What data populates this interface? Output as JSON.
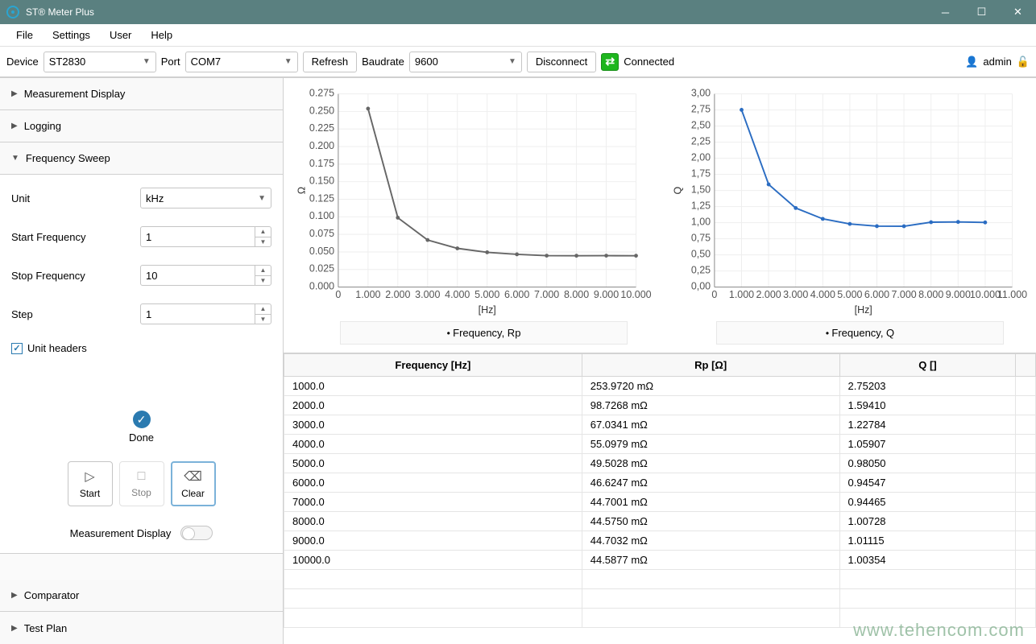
{
  "window": {
    "title": "ST® Meter Plus"
  },
  "menubar": {
    "items": [
      "File",
      "Settings",
      "User",
      "Help"
    ]
  },
  "toolbar": {
    "device_label": "Device",
    "device_value": "ST2830",
    "port_label": "Port",
    "port_value": "COM7",
    "refresh": "Refresh",
    "baudrate_label": "Baudrate",
    "baudrate_value": "9600",
    "disconnect": "Disconnect",
    "status": "Connected",
    "user": "admin"
  },
  "sidebar": {
    "sections": {
      "measurement_display": "Measurement Display",
      "logging": "Logging",
      "frequency_sweep": "Frequency Sweep",
      "comparator": "Comparator",
      "test_plan": "Test Plan"
    },
    "sweep": {
      "unit_label": "Unit",
      "unit_value": "kHz",
      "start_label": "Start Frequency",
      "start_value": "1",
      "stop_label": "Stop Frequency",
      "stop_value": "10",
      "step_label": "Step",
      "step_value": "1",
      "unit_headers": "Unit headers"
    },
    "done_label": "Done",
    "buttons": {
      "start": "Start",
      "stop": "Stop",
      "clear": "Clear"
    },
    "toggle_label": "Measurement Display"
  },
  "chart_data": [
    {
      "type": "line",
      "title": "",
      "xlabel": "[Hz]",
      "ylabel": "Ω",
      "legend": "Frequency, Rp",
      "x": [
        1000,
        2000,
        3000,
        4000,
        5000,
        6000,
        7000,
        8000,
        9000,
        10000
      ],
      "y": [
        0.254,
        0.0987,
        0.067,
        0.0551,
        0.0495,
        0.0466,
        0.0447,
        0.0446,
        0.0447,
        0.0446
      ],
      "xlim": [
        0,
        10000
      ],
      "ylim": [
        0,
        0.275
      ],
      "xticks": [
        0,
        1000,
        2000,
        3000,
        4000,
        5000,
        6000,
        7000,
        8000,
        9000,
        10000
      ],
      "yticks": [
        0.0,
        0.025,
        0.05,
        0.075,
        0.1,
        0.125,
        0.15,
        0.175,
        0.2,
        0.225,
        0.25,
        0.275
      ],
      "yticklabels": [
        "0.000",
        "0.025",
        "0.050",
        "0.075",
        "0.100",
        "0.125",
        "0.150",
        "0.175",
        "0.200",
        "0.225",
        "0.250",
        "0.275"
      ],
      "color": "#666"
    },
    {
      "type": "line",
      "title": "",
      "xlabel": "[Hz]",
      "ylabel": "Q",
      "legend": "Frequency, Q",
      "x": [
        1000,
        2000,
        3000,
        4000,
        5000,
        6000,
        7000,
        8000,
        9000,
        10000
      ],
      "y": [
        2.75203,
        1.5941,
        1.22784,
        1.05907,
        0.9805,
        0.94547,
        0.94465,
        1.00728,
        1.01115,
        1.00354
      ],
      "xlim": [
        0,
        11000
      ],
      "ylim": [
        0,
        3.0
      ],
      "xticks": [
        0,
        1000,
        2000,
        3000,
        4000,
        5000,
        6000,
        7000,
        8000,
        9000,
        10000,
        11000
      ],
      "yticks": [
        0.0,
        0.25,
        0.5,
        0.75,
        1.0,
        1.25,
        1.5,
        1.75,
        2.0,
        2.25,
        2.5,
        2.75,
        3.0
      ],
      "yticklabels": [
        "0,00",
        "0,25",
        "0,50",
        "0,75",
        "1,00",
        "1,25",
        "1,50",
        "1,75",
        "2,00",
        "2,25",
        "2,50",
        "2,75",
        "3,00"
      ],
      "color": "#2a6cc2"
    }
  ],
  "table": {
    "headers": [
      "Frequency [Hz]",
      "Rp [Ω]",
      "Q []"
    ],
    "rows": [
      [
        "1000.0",
        "253.9720 mΩ",
        "2.75203"
      ],
      [
        "2000.0",
        "98.7268 mΩ",
        "1.59410"
      ],
      [
        "3000.0",
        "67.0341 mΩ",
        "1.22784"
      ],
      [
        "4000.0",
        "55.0979 mΩ",
        "1.05907"
      ],
      [
        "5000.0",
        "49.5028 mΩ",
        "0.98050"
      ],
      [
        "6000.0",
        "46.6247 mΩ",
        "0.94547"
      ],
      [
        "7000.0",
        "44.7001 mΩ",
        "0.94465"
      ],
      [
        "8000.0",
        "44.5750 mΩ",
        "1.00728"
      ],
      [
        "9000.0",
        "44.7032 mΩ",
        "1.01115"
      ],
      [
        "10000.0",
        "44.5877 mΩ",
        "1.00354"
      ]
    ]
  },
  "watermark": "www.tehencom.com"
}
